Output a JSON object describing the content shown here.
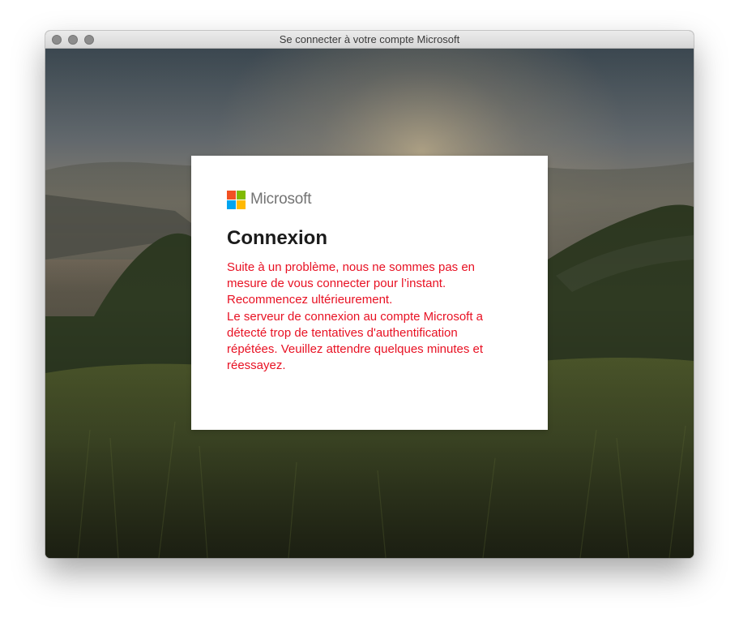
{
  "window": {
    "title": "Se connecter à votre compte Microsoft"
  },
  "brand": {
    "name": "Microsoft",
    "logo_colors": [
      "#f25022",
      "#7fba00",
      "#00a4ef",
      "#ffb900"
    ]
  },
  "dialog": {
    "heading": "Connexion",
    "error_lines": [
      "Suite à un problème, nous ne sommes pas en",
      "mesure de vous connecter pour l’instant.",
      "Recommencez ultérieurement.",
      "Le serveur de connexion au compte Microsoft a",
      "détecté trop de tentatives d'authentification",
      "répétées. Veuillez attendre quelques minutes et",
      "réessayez."
    ],
    "error_color": "#e81123"
  }
}
